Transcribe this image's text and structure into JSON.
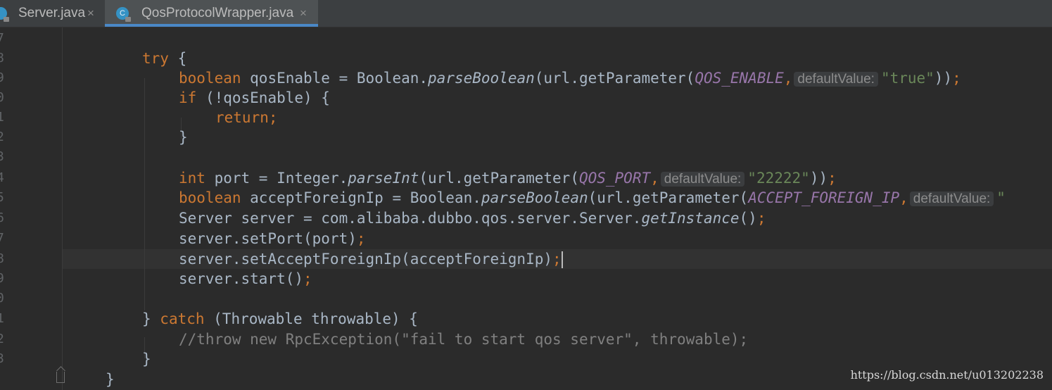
{
  "tabs": [
    {
      "label": "Server.java",
      "icon": "interface-lock-icon",
      "active": false
    },
    {
      "label": "QosProtocolWrapper.java",
      "icon": "class-lock-icon",
      "active": true
    }
  ],
  "tab_close_glyph": "×",
  "class_icon_letter": "C",
  "line_numbers": [
    "7",
    "8",
    "9",
    "0",
    "1",
    "2",
    "3",
    "4",
    "5",
    "6",
    "7",
    "8",
    "9",
    "0",
    "1",
    "2",
    "3",
    ""
  ],
  "code": {
    "l2": {
      "kw": "try",
      "rest": " {"
    },
    "l3": {
      "kw": "boolean",
      "a": " qosEnable = Boolean.",
      "m": "parseBoolean",
      "b": "(url.getParameter(",
      "c": "QOS_ENABLE",
      "d": ",",
      "hint": "defaultValue:",
      "s": "\"true\"",
      "e": "))",
      "semi": ";"
    },
    "l4": {
      "kw": "if",
      "rest": " (!qosEnable) {"
    },
    "l5": {
      "kw": "return",
      "semi": ";"
    },
    "l6": {
      "rest": "}"
    },
    "l8": {
      "kw": "int",
      "a": " port = Integer.",
      "m": "parseInt",
      "b": "(url.getParameter(",
      "c": "QOS_PORT",
      "d": ",",
      "hint": "defaultValue:",
      "s": "\"22222\"",
      "e": "))",
      "semi": ";"
    },
    "l9": {
      "kw": "boolean",
      "a": " acceptForeignIp = Boolean.",
      "m": "parseBoolean",
      "b": "(url.getParameter(",
      "c": "ACCEPT_FOREIGN_IP",
      "d": ",",
      "hint": "defaultValue:",
      "s": "\""
    },
    "l10": {
      "a": "Server server = com.alibaba.dubbo.qos.server.Server.",
      "m": "getInstance",
      "e": "()",
      "semi": ";"
    },
    "l11": {
      "a": "server.setPort(port)",
      "semi": ";"
    },
    "l12": {
      "a": "server.setAcceptForeignIp(acceptForeignIp)",
      "semi": ";"
    },
    "l13": {
      "a": "server.start()",
      "semi": ";"
    },
    "l15": {
      "a": "} ",
      "kw": "catch",
      "b": " (Throwable throwable) {"
    },
    "l16": {
      "cmt": "//throw new RpcException(\"fail to start qos server\", throwable);"
    },
    "l17": {
      "rest": "}"
    },
    "l18": {
      "rest": "}"
    }
  },
  "watermark": "https://blog.csdn.net/u013202238",
  "colors": {
    "background": "#2b2b2b",
    "keyword": "#cc7832",
    "constant": "#9876aa",
    "string": "#6a8759",
    "comment": "#808080",
    "tab_active_underline": "#4a88c7"
  }
}
